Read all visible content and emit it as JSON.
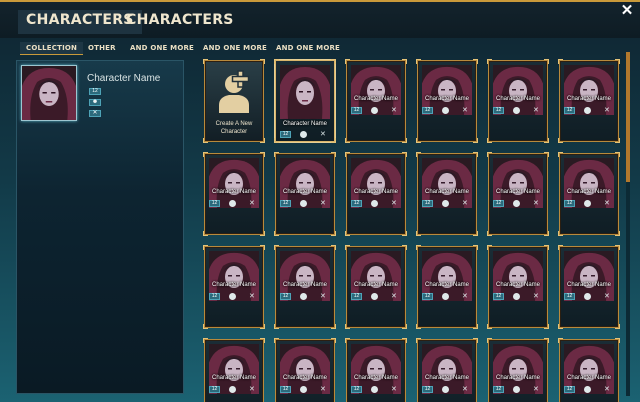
{
  "header": {
    "tabs": [
      {
        "label": "CHARACTERS"
      },
      {
        "label": "CHARACTERS"
      }
    ]
  },
  "subtabs": [
    {
      "label": "COLLECTION"
    },
    {
      "label": "OTHER"
    },
    {
      "label": "AND ONE MORE"
    },
    {
      "label": "AND ONE MORE"
    },
    {
      "label": "AND ONE MORE"
    }
  ],
  "selected": {
    "name": "Character Name",
    "level": "12"
  },
  "create": {
    "label": "Create A New Character"
  },
  "cards": [
    {
      "name": "Character Name",
      "level": "12"
    },
    {
      "name": "Character Name",
      "level": "12"
    },
    {
      "name": "Character Name",
      "level": "12"
    },
    {
      "name": "Character Name",
      "level": "12"
    },
    {
      "name": "Character Name",
      "level": "12"
    },
    {
      "name": "Character Name",
      "level": "12"
    },
    {
      "name": "Character Name",
      "level": "12"
    },
    {
      "name": "Character Name",
      "level": "12"
    },
    {
      "name": "Character Name",
      "level": "12"
    },
    {
      "name": "Character Name",
      "level": "12"
    },
    {
      "name": "Character Name",
      "level": "12"
    },
    {
      "name": "Character Name",
      "level": "12"
    },
    {
      "name": "Character Name",
      "level": "12"
    },
    {
      "name": "Character Name",
      "level": "12"
    },
    {
      "name": "Character Name",
      "level": "12"
    },
    {
      "name": "Character Name",
      "level": "12"
    },
    {
      "name": "Character Name",
      "level": "12"
    },
    {
      "name": "Character Name",
      "level": "12"
    },
    {
      "name": "Character Name",
      "level": "12"
    },
    {
      "name": "Character Name",
      "level": "12"
    },
    {
      "name": "Character Name",
      "level": "12"
    },
    {
      "name": "Character Name",
      "level": "12"
    },
    {
      "name": "Character Name",
      "level": "12"
    }
  ]
}
